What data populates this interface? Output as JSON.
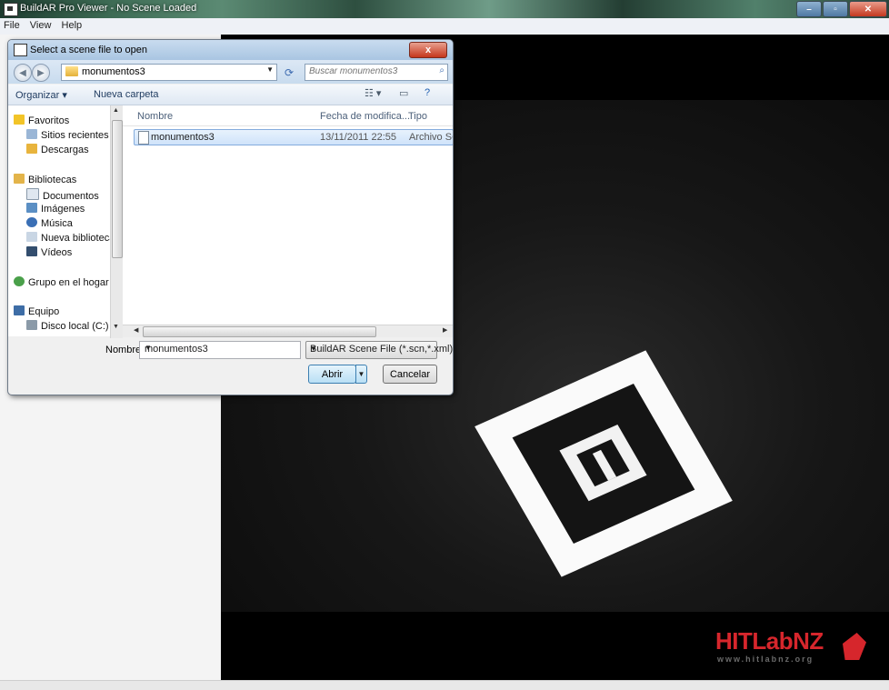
{
  "app": {
    "title": "BuildAR Pro Viewer - No Scene Loaded",
    "menu": [
      "File",
      "View",
      "Help"
    ]
  },
  "dialog": {
    "title": "Select a scene file to open",
    "close_label": "x",
    "breadcrumb": "monumentos3",
    "search_placeholder": "Buscar monumentos3",
    "toolbar": {
      "organize": "Organizar ▾",
      "new_folder": "Nueva carpeta"
    },
    "nav": [
      "Favoritos",
      "Sitios recientes",
      "Descargas",
      "Bibliotecas",
      "Documentos",
      "Imágenes",
      "Música",
      "Nueva biblioteca",
      "Vídeos",
      "Grupo en el hogar",
      "Equipo",
      "Disco local (C:)"
    ],
    "columns": {
      "name": "Nombre",
      "date": "Fecha de modifica...",
      "type": "Tipo"
    },
    "files": [
      {
        "name": "monumentos3",
        "date": "13/11/2011 22:55",
        "type": "Archivo SCN"
      }
    ],
    "filename_label": "Nombre:",
    "filename_value": "monumentos3",
    "filetype": "BuildAR Scene File (*.scn,*.xml)",
    "open_label": "Abrir",
    "cancel_label": "Cancelar"
  },
  "viewport": {
    "logo_text": "HITLabNZ",
    "logo_url": "www.hitlabnz.org"
  },
  "colors": {
    "logo_red": "#d6262c",
    "selection": "#cfe3fa"
  }
}
